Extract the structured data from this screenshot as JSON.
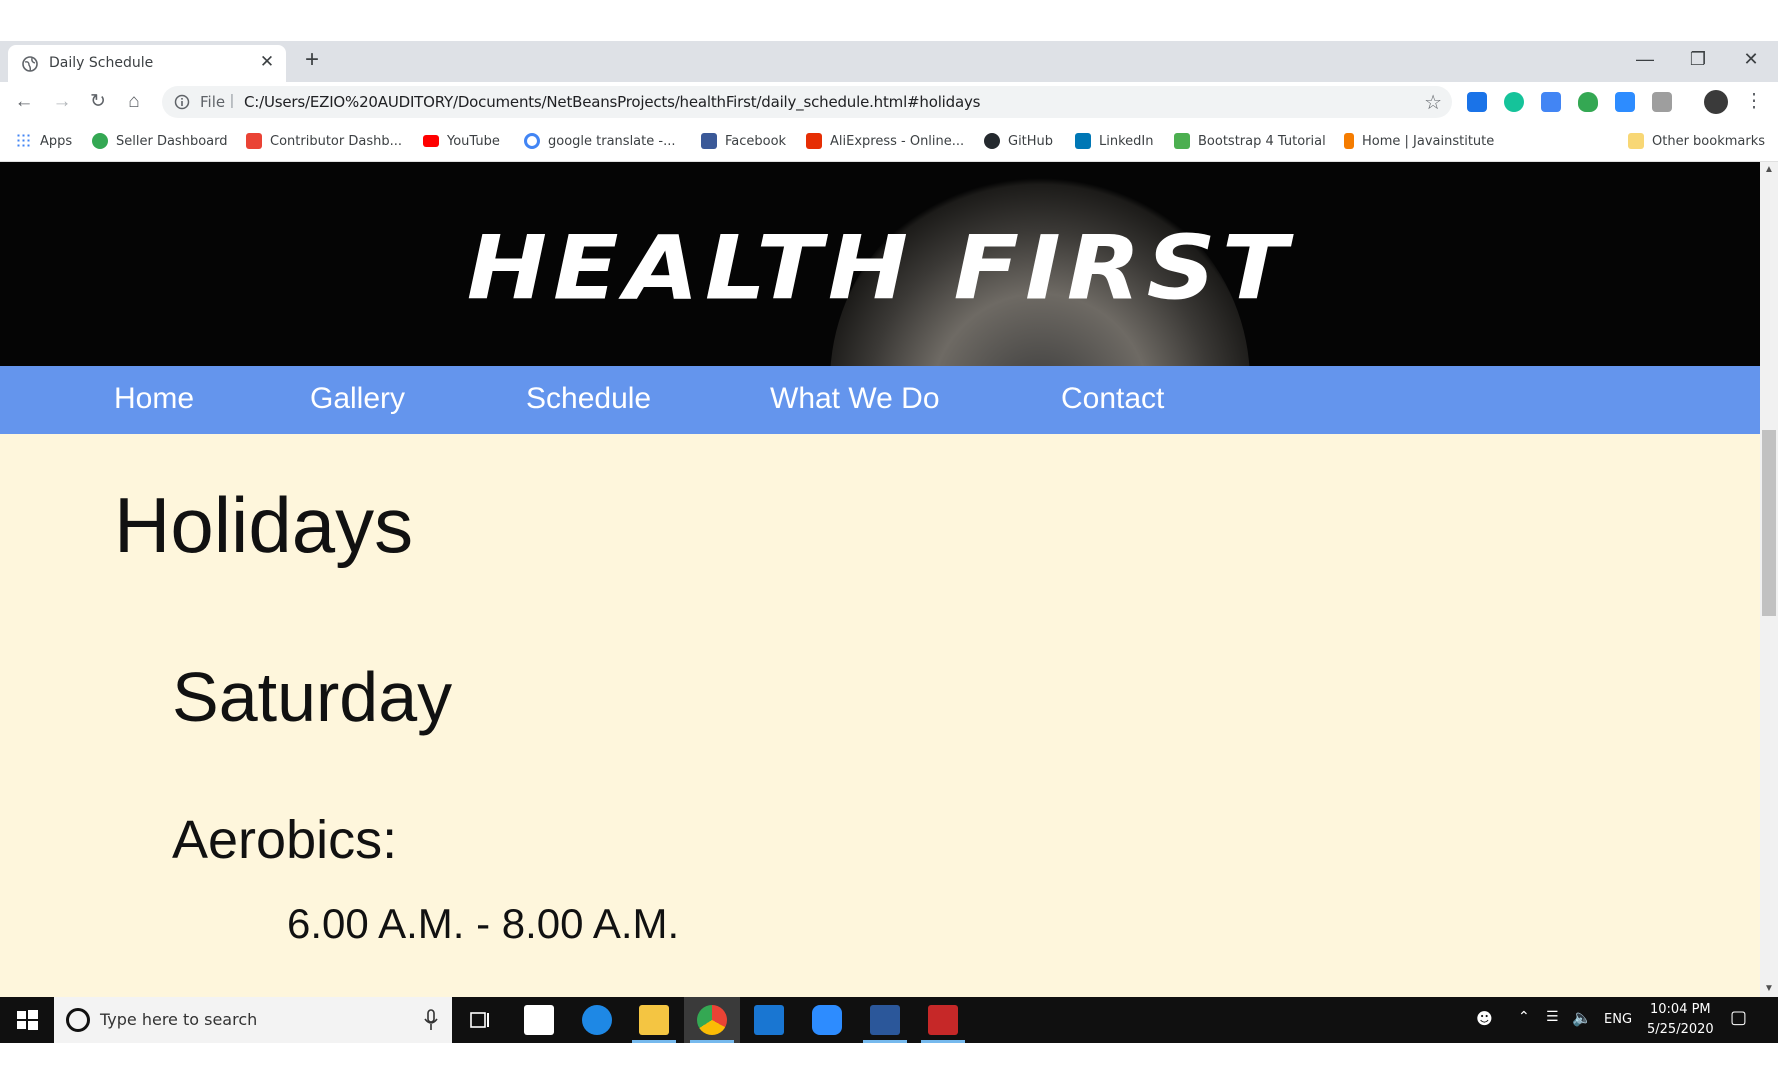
{
  "browser": {
    "tab_title": "Daily Schedule",
    "tab_close": "✕",
    "new_tab": "+",
    "url_scheme": "File",
    "url": "C:/Users/EZIO%20AUDITORY/Documents/NetBeansProjects/healthFirst/daily_schedule.html#holidays",
    "icons": [
      "back-icon",
      "forward-icon",
      "reload-icon",
      "home-icon",
      "info-icon",
      "star-icon",
      "menu-icon"
    ]
  },
  "bookmarks": [
    {
      "label": "Apps",
      "color": "#4285f4"
    },
    {
      "label": "Seller Dashboard",
      "color": "#34a853"
    },
    {
      "label": "Contributor Dashb...",
      "color": "#ea4335"
    },
    {
      "label": "YouTube",
      "color": "#ff0000"
    },
    {
      "label": "google translate -...",
      "color": "#4285f4"
    },
    {
      "label": "Facebook",
      "color": "#3b5998"
    },
    {
      "label": "AliExpress - Online...",
      "color": "#e62e04"
    },
    {
      "label": "GitHub",
      "color": "#24292e"
    },
    {
      "label": "LinkedIn",
      "color": "#0077b5"
    },
    {
      "label": "Bootstrap 4 Tutorial",
      "color": "#4caf50"
    },
    {
      "label": "Home | Javainstitute",
      "color": "#f57c00"
    },
    {
      "label": "Other bookmarks",
      "color": "#f8d775"
    }
  ],
  "page": {
    "logo": "HEALTH FIRST",
    "nav": [
      "Home",
      "Gallery",
      "Schedule",
      "What We Do",
      "Contact"
    ],
    "section_title": "Holidays",
    "day": "Saturday",
    "class_name": "Aerobics:",
    "time": "6.00 A.M. - 8.00 A.M.",
    "colors": {
      "nav": "#6495ed",
      "background": "#fef6dc",
      "hero": "#050505"
    }
  },
  "taskbar": {
    "search_placeholder": "Type here to search",
    "language": "ENG",
    "time": "10:04 PM",
    "date": "5/25/2020"
  }
}
